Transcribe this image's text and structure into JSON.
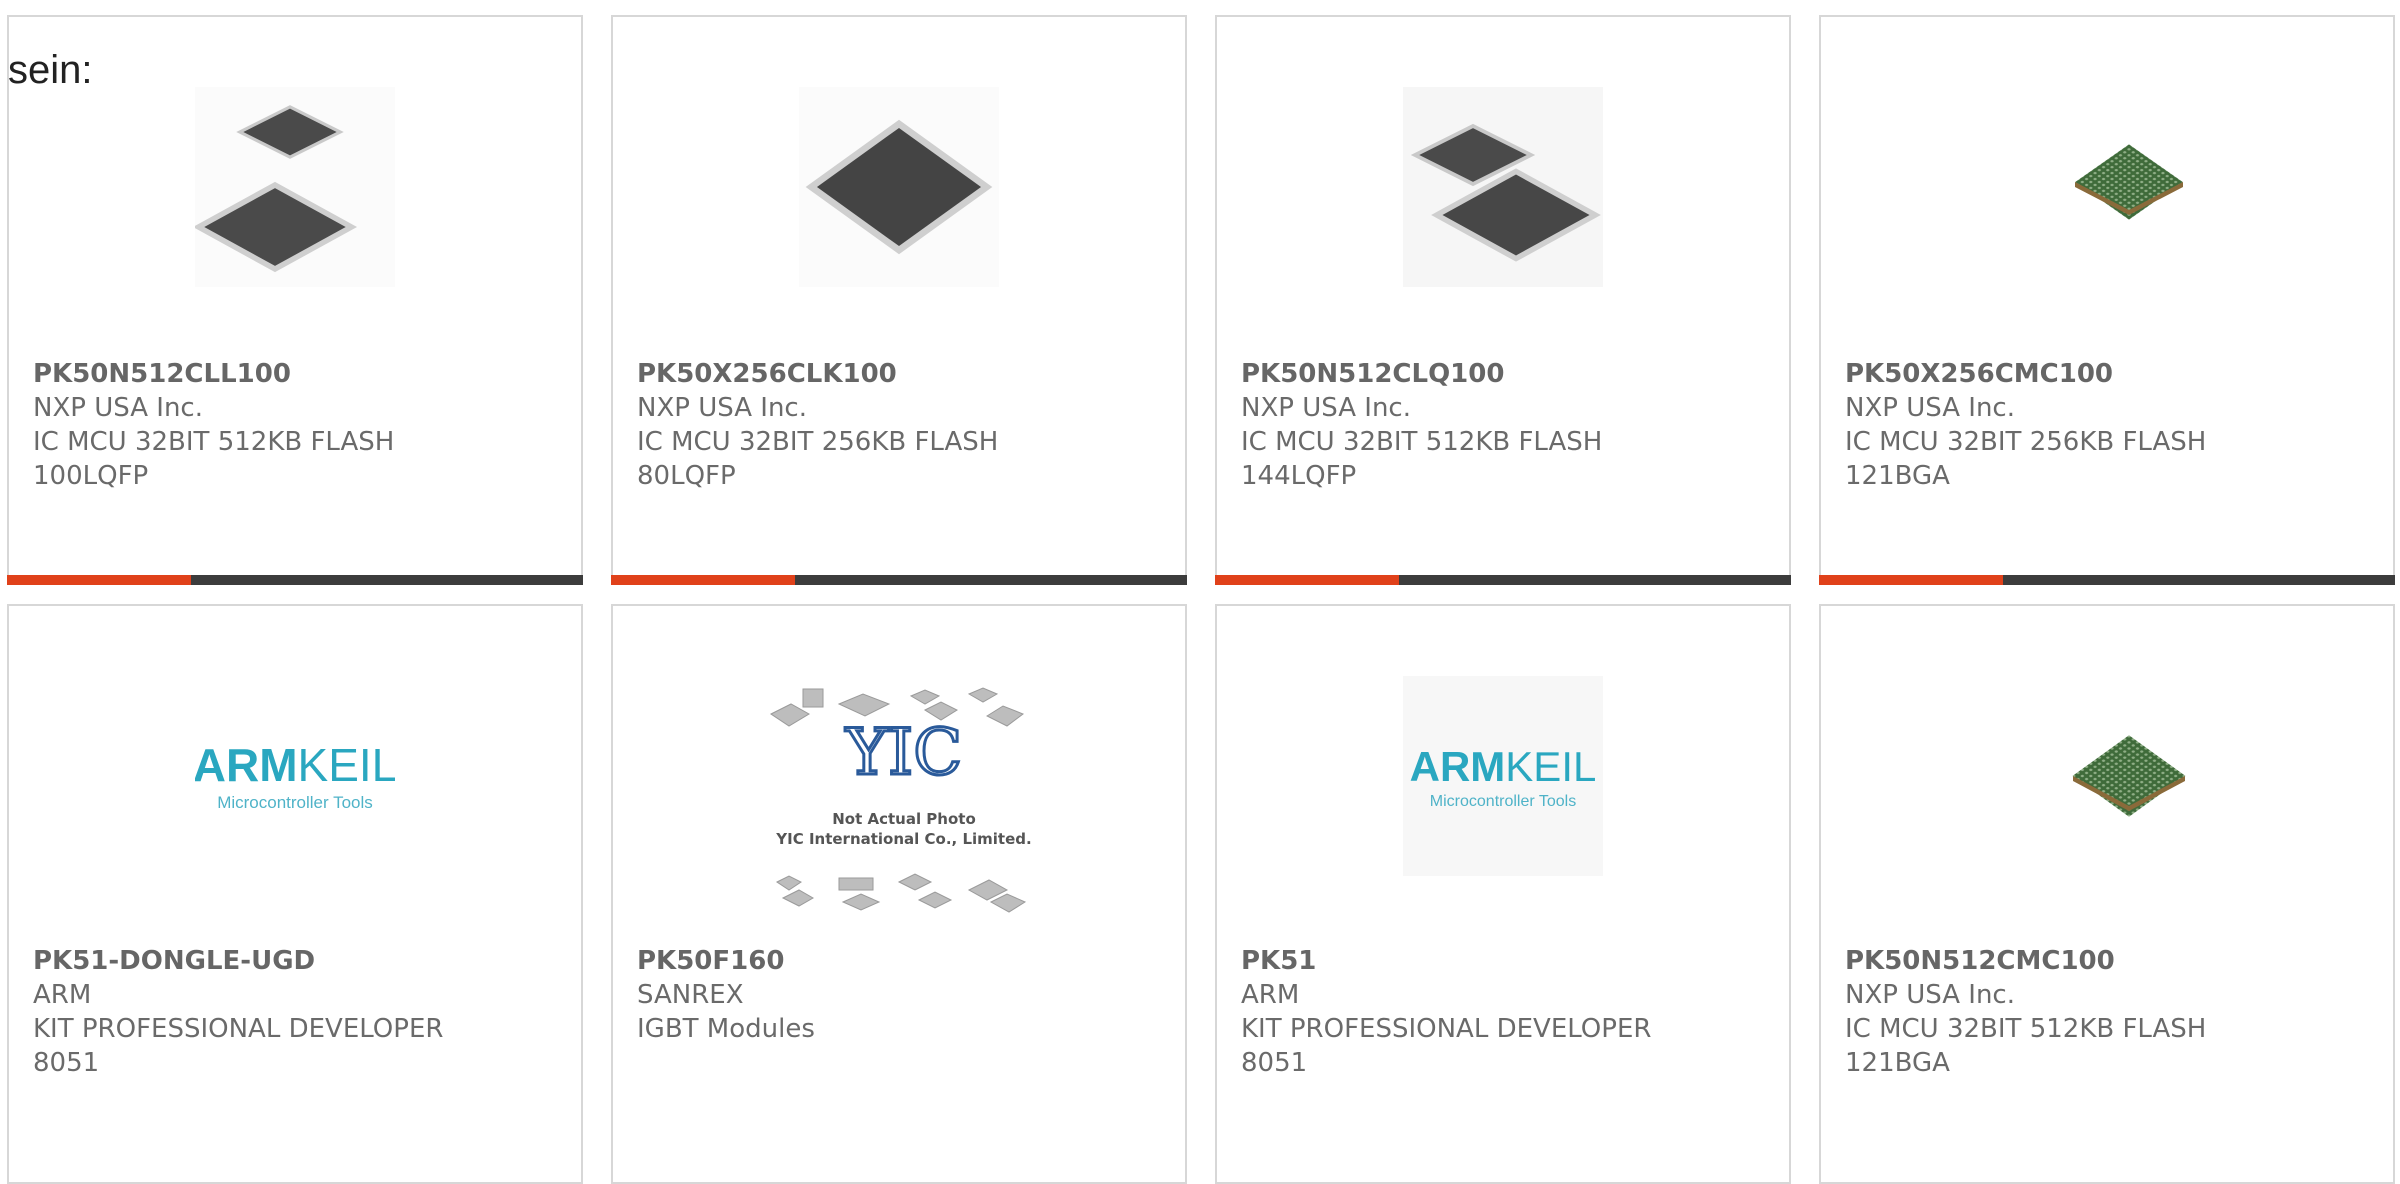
{
  "lead_text": "sein:",
  "colors": {
    "accent": "#e0411a",
    "bar": "#3c3c3c",
    "border": "#d7d7d7",
    "text": "#6a6a6a"
  },
  "cards": [
    {
      "part": "PK50N512CLL100",
      "maker": "NXP USA Inc.",
      "desc1": "IC MCU 32BIT 512KB FLASH",
      "desc2": "100LQFP",
      "image": "lqfp-chip-pair-icon",
      "accent": true
    },
    {
      "part": "PK50X256CLK100",
      "maker": "NXP USA Inc.",
      "desc1": "IC MCU 32BIT 256KB FLASH",
      "desc2": "80LQFP",
      "image": "lqfp-chip-icon",
      "accent": true
    },
    {
      "part": "PK50N512CLQ100",
      "maker": "NXP USA Inc.",
      "desc1": "IC MCU 32BIT 512KB FLASH",
      "desc2": "144LQFP",
      "image": "lqfp-chip-pair-icon",
      "accent": true
    },
    {
      "part": "PK50X256CMC100",
      "maker": "NXP USA Inc.",
      "desc1": "IC MCU 32BIT 256KB FLASH",
      "desc2": "121BGA",
      "image": "bga-chip-icon",
      "accent": true
    },
    {
      "part": "PK51-DONGLE-UGD",
      "maker": "ARM",
      "desc1": "KIT PROFESSIONAL DEVELOPER",
      "desc2": "8051",
      "image": "arm-keil-logo",
      "logo_a": "ARM",
      "logo_b": "KEIL",
      "logo_sub": "Microcontroller Tools",
      "accent": false
    },
    {
      "part": "PK50F160",
      "maker": "SANREX",
      "desc1": "IGBT Modules",
      "desc2": "",
      "image": "yic-placeholder",
      "logo_yic": "YIC",
      "note1": "Not Actual Photo",
      "note2": "YIC International Co., Limited.",
      "accent": false
    },
    {
      "part": "PK51",
      "maker": "ARM",
      "desc1": "KIT PROFESSIONAL DEVELOPER",
      "desc2": "8051",
      "image": "arm-keil-logo",
      "logo_a": "ARM",
      "logo_b": "KEIL",
      "logo_sub": "Microcontroller Tools",
      "accent": false
    },
    {
      "part": "PK50N512CMC100",
      "maker": "NXP USA Inc.",
      "desc1": "IC MCU 32BIT 512KB FLASH",
      "desc2": "121BGA",
      "image": "bga-chip-icon",
      "accent": false
    }
  ]
}
